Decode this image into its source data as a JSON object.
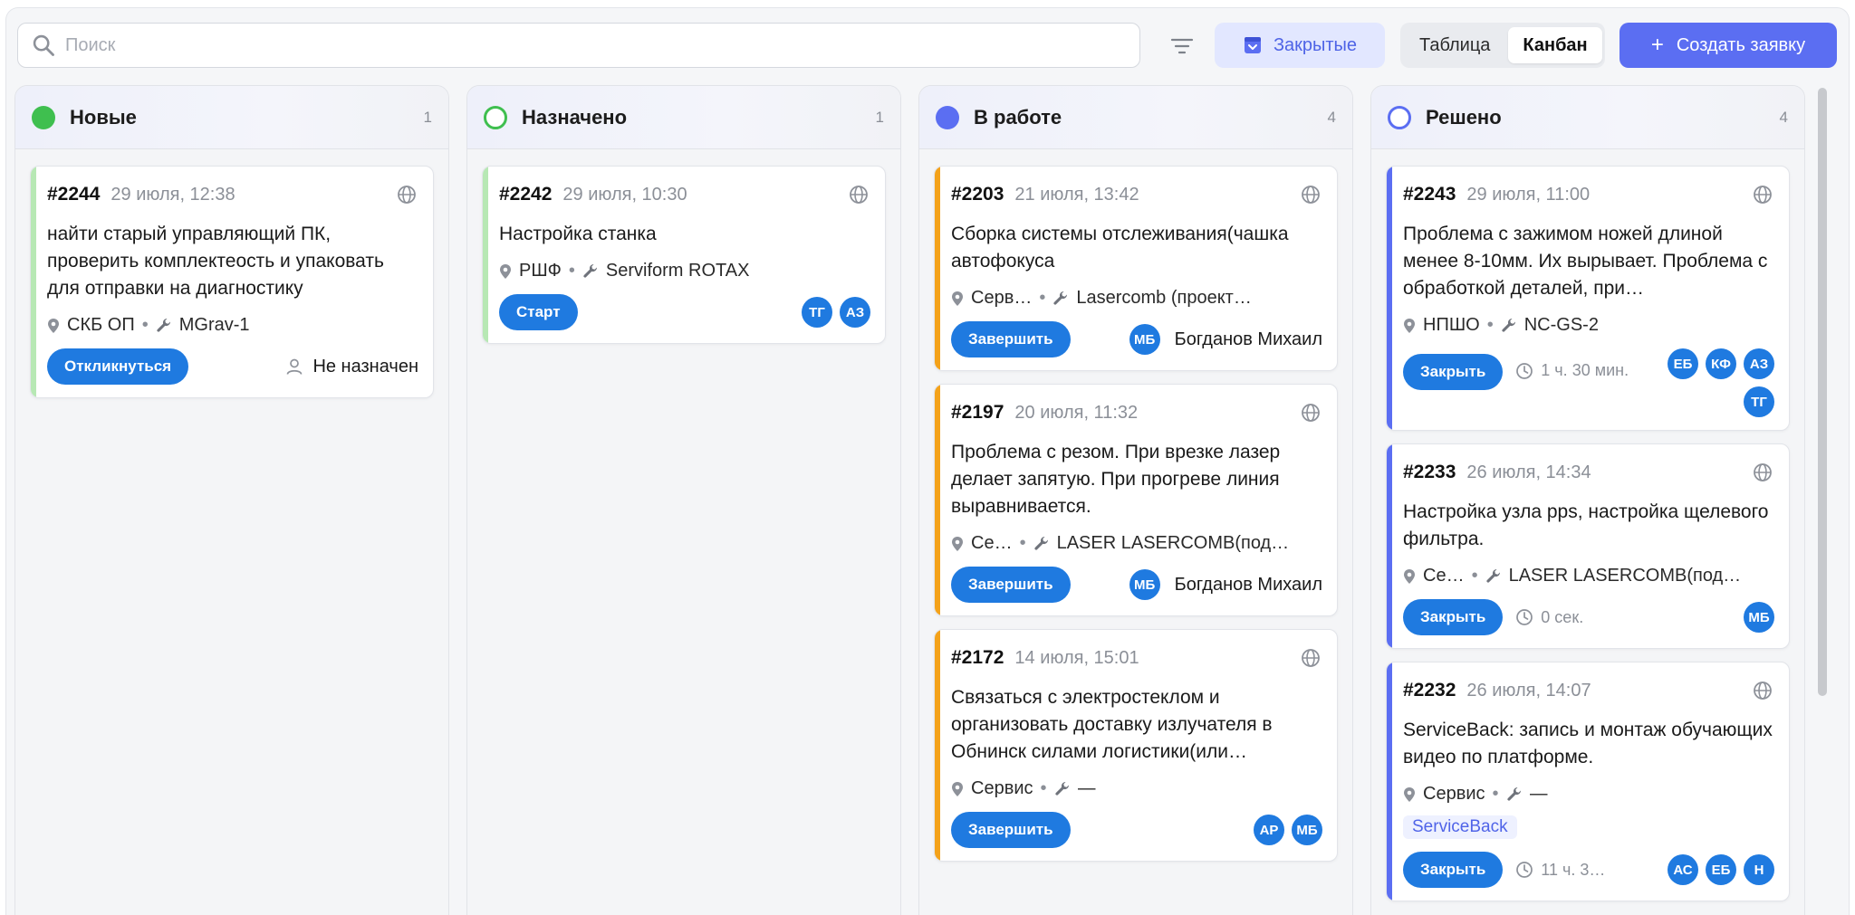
{
  "toolbar": {
    "search_placeholder": "Поиск",
    "closed_label": "Закрытые",
    "view_table": "Таблица",
    "view_kanban": "Канбан",
    "create_label": "Создать заявку",
    "create_plus": "+"
  },
  "colors": {
    "accent": "#5b6ef2",
    "button_blue": "#1f7ae0",
    "new": "#3fbf4f",
    "assigned": "#3fbf4f",
    "in_progress": "#5b6ef2",
    "resolved": "#5b6ef2",
    "stripe_new": "#b7e8b4",
    "stripe_progress": "#f4a21a",
    "stripe_resolved": "#5b6ef2"
  },
  "columns": [
    {
      "title": "Новые",
      "count": "1",
      "cards": [
        {
          "num": "#2244",
          "date": "29 июля, 12:38",
          "title": "найти старый управляющий ПК, проверить комплектеость и упаковать для отправки на диагностику",
          "location": "СКБ ОП",
          "equipment": "MGrav-1",
          "action": "Откликнуться",
          "assignee": "Не назначен"
        }
      ]
    },
    {
      "title": "Назначено",
      "count": "1",
      "cards": [
        {
          "num": "#2242",
          "date": "29 июля, 10:30",
          "title": "Настройка станка",
          "location": "РШФ",
          "equipment": "Serviform ROTAX",
          "action": "Старт",
          "avatars": [
            "ТГ",
            "АЗ"
          ]
        }
      ]
    },
    {
      "title": "В работе",
      "count": "4",
      "cards": [
        {
          "num": "#2203",
          "date": "21 июля, 13:42",
          "title": "Сборка системы отслеживания(чашка автофокуса",
          "location": "Серв…",
          "equipment": "Lasercomb (проект…",
          "action": "Завершить",
          "avatars": [
            "МБ"
          ],
          "assignee": "Богданов Михаил"
        },
        {
          "num": "#2197",
          "date": "20 июля, 11:32",
          "title": "Проблема с резом. При врезке лазер делает запятую. При прогреве линия выравнивается.",
          "location": "Се…",
          "equipment": "LASER LASERCOMB(под…",
          "action": "Завершить",
          "avatars": [
            "МБ"
          ],
          "assignee": "Богданов Михаил"
        },
        {
          "num": "#2172",
          "date": "14 июля, 15:01",
          "title": "Связаться с электростеклом и организовать доставку излучателя в Обнинск силами логистики(или самовывоз)",
          "location": "Сервис",
          "equipment": "—",
          "action": "Завершить",
          "avatars": [
            "АР",
            "МБ"
          ]
        }
      ]
    },
    {
      "title": "Решено",
      "count": "4",
      "cards": [
        {
          "num": "#2243",
          "date": "29 июля, 11:00",
          "title": "Проблема с зажимом ножей длиной менее 8-10мм. Их вырывает. Проблема с обработкой деталей, при…",
          "location": "НПШО",
          "equipment": "NC-GS-2",
          "action": "Закрыть",
          "timer": "1 ч. 30 мин.",
          "avatars": [
            "ЕБ",
            "КФ",
            "АЗ",
            "ТГ"
          ]
        },
        {
          "num": "#2233",
          "date": "26 июля, 14:34",
          "title": "Настройка узла pps, настройка щелевого фильтра.",
          "location": "Се…",
          "equipment": "LASER LASERCOMB(под…",
          "action": "Закрыть",
          "timer": "0 сек.",
          "avatars": [
            "МБ"
          ]
        },
        {
          "num": "#2232",
          "date": "26 июля, 14:07",
          "title": "ServiceBack: запись и монтаж обучающих видео по платформе.",
          "location": "Сервис",
          "equipment": "—",
          "tag": "ServiceBack",
          "action": "Закрыть",
          "timer": "11 ч. 3…",
          "avatars": [
            "АС",
            "ЕБ",
            "Н"
          ]
        }
      ]
    }
  ]
}
